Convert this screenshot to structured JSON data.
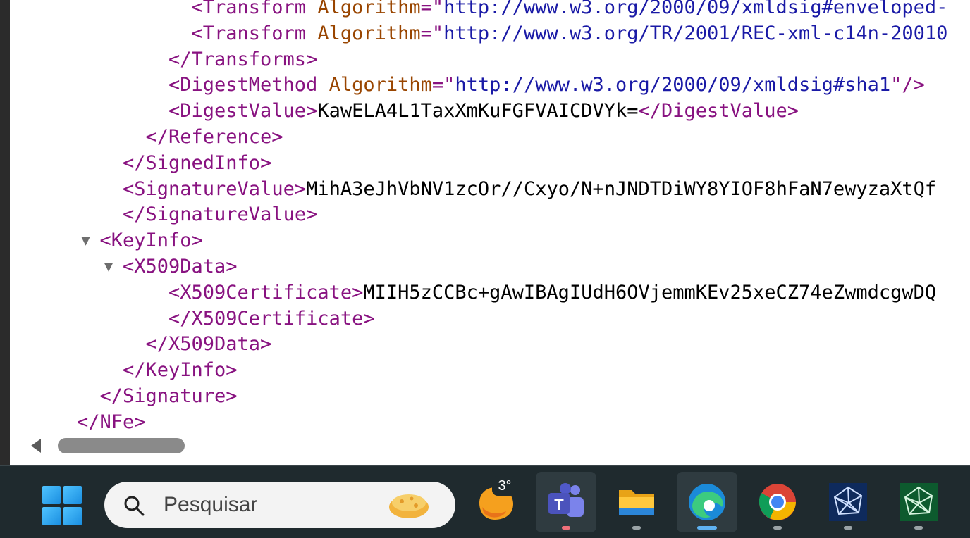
{
  "xml_lines": [
    {
      "indent": 7,
      "parts": [
        [
          "tag",
          "<Transform "
        ],
        [
          "attr",
          "Algorithm"
        ],
        [
          "tag",
          "=\""
        ],
        [
          "val",
          "http://www.w3.org/2000/09/xmldsig#enveloped-"
        ]
      ]
    },
    {
      "indent": 7,
      "parts": [
        [
          "tag",
          "<Transform "
        ],
        [
          "attr",
          "Algorithm"
        ],
        [
          "tag",
          "=\""
        ],
        [
          "val",
          "http://www.w3.org/TR/2001/REC-xml-c14n-20010"
        ]
      ]
    },
    {
      "indent": 6,
      "parts": [
        [
          "tag",
          "</Transforms>"
        ]
      ]
    },
    {
      "indent": 6,
      "parts": [
        [
          "tag",
          "<DigestMethod "
        ],
        [
          "attr",
          "Algorithm"
        ],
        [
          "tag",
          "=\""
        ],
        [
          "val",
          "http://www.w3.org/2000/09/xmldsig#sha1"
        ],
        [
          "tag",
          "\"/>"
        ]
      ]
    },
    {
      "indent": 6,
      "parts": [
        [
          "tag",
          "<DigestValue>"
        ],
        [
          "txt",
          "KawELA4L1TaxXmKuFGFVAICDVYk="
        ],
        [
          "tag",
          "</DigestValue>"
        ]
      ]
    },
    {
      "indent": 5,
      "parts": [
        [
          "tag",
          "</Reference>"
        ]
      ]
    },
    {
      "indent": 4,
      "parts": [
        [
          "tag",
          "</SignedInfo>"
        ]
      ]
    },
    {
      "indent": 4,
      "parts": [
        [
          "tag",
          "<SignatureValue>"
        ],
        [
          "txt",
          "MihA3eJhVbNV1zcOr//Cxyo/N+nJNDTDiWY8YIOF8hFaN7ewyzaXtQf"
        ]
      ]
    },
    {
      "indent": 4,
      "parts": [
        [
          "tag",
          "</SignatureValue>"
        ]
      ]
    },
    {
      "indent": 3,
      "toggle": true,
      "parts": [
        [
          "tag",
          "<KeyInfo>"
        ]
      ]
    },
    {
      "indent": 4,
      "toggle": true,
      "parts": [
        [
          "tag",
          "<X509Data>"
        ]
      ]
    },
    {
      "indent": 6,
      "parts": [
        [
          "tag",
          "<X509Certificate>"
        ],
        [
          "txt",
          "MIIH5zCCBc+gAwIBAgIUdH6OVjemmKEv25xeCZ74eZwmdcgwDQ"
        ]
      ]
    },
    {
      "indent": 6,
      "parts": [
        [
          "tag",
          "</X509Certificate>"
        ]
      ]
    },
    {
      "indent": 5,
      "parts": [
        [
          "tag",
          "</X509Data>"
        ]
      ]
    },
    {
      "indent": 4,
      "parts": [
        [
          "tag",
          "</KeyInfo>"
        ]
      ]
    },
    {
      "indent": 3,
      "parts": [
        [
          "tag",
          "</Signature>"
        ]
      ]
    },
    {
      "indent": 2,
      "parts": [
        [
          "tag",
          "</NFe>"
        ]
      ]
    }
  ],
  "toggle_glyph": "▼",
  "taskbar": {
    "search_placeholder": "Pesquisar",
    "weather_badge": "3°",
    "apps": [
      {
        "name": "weather",
        "icon": "weather-icon"
      },
      {
        "name": "teams",
        "icon": "teams-icon",
        "running": true
      },
      {
        "name": "file-explorer",
        "icon": "folder-icon",
        "running": true
      },
      {
        "name": "edge",
        "icon": "edge-icon",
        "active": true
      },
      {
        "name": "chrome",
        "icon": "chrome-icon",
        "running": true
      },
      {
        "name": "app-network-blue",
        "icon": "network-blue-icon",
        "running": true
      },
      {
        "name": "app-network-green",
        "icon": "network-green-icon",
        "running": true
      }
    ]
  },
  "colors": {
    "tag": "#881280",
    "attribute": "#994500",
    "value": "#1a1aa6",
    "text": "#000000",
    "taskbar_bg": "#1f2a2e"
  }
}
